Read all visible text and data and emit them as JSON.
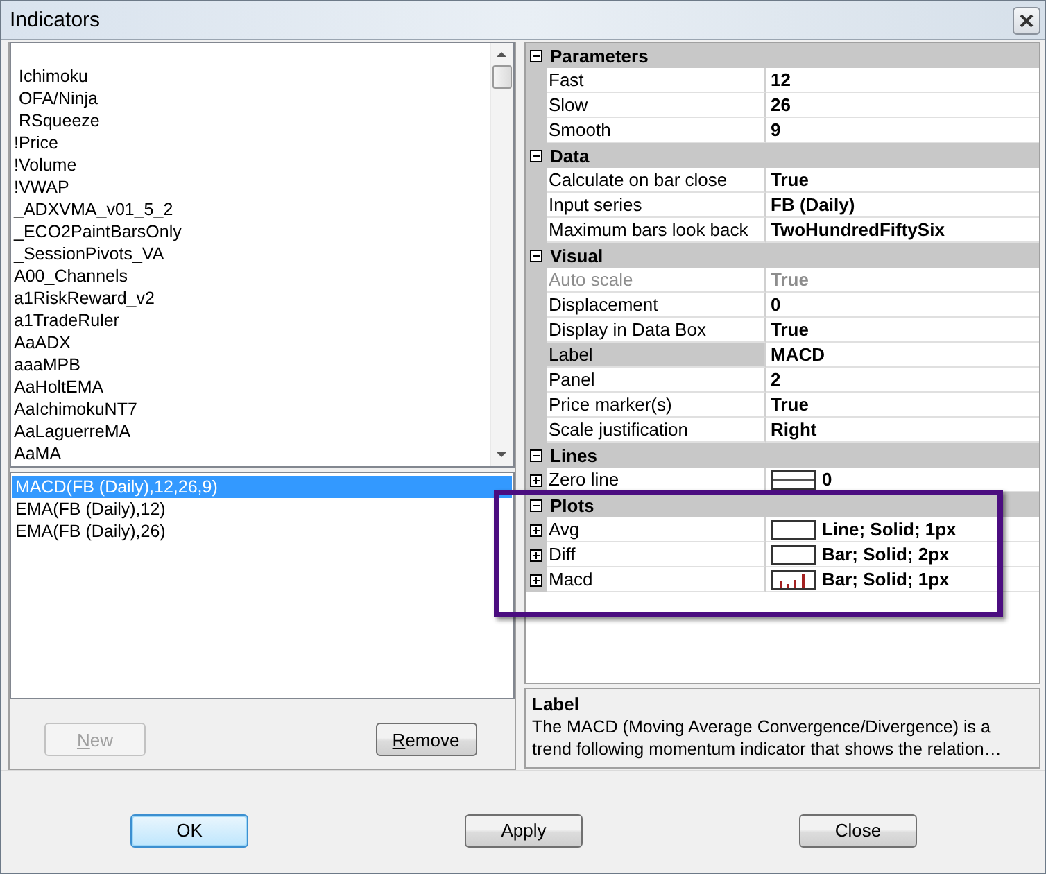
{
  "window": {
    "title": "Indicators"
  },
  "available_indicators": [
    " Ichimoku",
    " OFA/Ninja",
    " RSqueeze",
    "!Price",
    "!Volume",
    "!VWAP",
    "_ADXVMA_v01_5_2",
    "_ECO2PaintBarsOnly",
    "_SessionPivots_VA",
    "A00_Channels",
    "a1RiskReward_v2",
    "a1TradeRuler",
    "AaADX",
    "aaaMPB",
    "AaHoltEMA",
    "AaIchimokuNT7",
    "AaLaguerreMA",
    "AaMA"
  ],
  "applied_indicators": [
    {
      "label": "MACD(FB (Daily),12,26,9)",
      "selected": true
    },
    {
      "label": "EMA(FB (Daily),12)",
      "selected": false
    },
    {
      "label": "EMA(FB (Daily),26)",
      "selected": false
    }
  ],
  "list_buttons": [
    {
      "label": "New",
      "disabled": true
    },
    {
      "label": "Remove",
      "disabled": false
    }
  ],
  "properties": [
    {
      "title": "Parameters",
      "expanded": true,
      "highlighted": false,
      "rows": [
        {
          "name": "Fast",
          "value": "12",
          "kind": "plain",
          "expandable": false,
          "disabled": false,
          "selected": false
        },
        {
          "name": "Slow",
          "value": "26",
          "kind": "plain",
          "expandable": false,
          "disabled": false,
          "selected": false
        },
        {
          "name": "Smooth",
          "value": "9",
          "kind": "plain",
          "expandable": false,
          "disabled": false,
          "selected": false
        }
      ]
    },
    {
      "title": "Data",
      "expanded": true,
      "highlighted": false,
      "rows": [
        {
          "name": "Calculate on bar close",
          "value": "True",
          "kind": "plain",
          "expandable": false,
          "disabled": false,
          "selected": false
        },
        {
          "name": "Input series",
          "value": "FB (Daily)",
          "kind": "plain",
          "expandable": false,
          "disabled": false,
          "selected": false
        },
        {
          "name": "Maximum bars look back",
          "value": "TwoHundredFiftySix",
          "kind": "plain",
          "expandable": false,
          "disabled": false,
          "selected": false
        }
      ]
    },
    {
      "title": "Visual",
      "expanded": true,
      "highlighted": false,
      "rows": [
        {
          "name": "Auto scale",
          "value": "True",
          "kind": "plain",
          "expandable": false,
          "disabled": true,
          "selected": false
        },
        {
          "name": "Displacement",
          "value": "0",
          "kind": "plain",
          "expandable": false,
          "disabled": false,
          "selected": false
        },
        {
          "name": "Display in Data Box",
          "value": "True",
          "kind": "plain",
          "expandable": false,
          "disabled": false,
          "selected": false
        },
        {
          "name": "Label",
          "value": "MACD",
          "kind": "plain",
          "expandable": false,
          "disabled": false,
          "selected": true
        },
        {
          "name": "Panel",
          "value": "2",
          "kind": "plain",
          "expandable": false,
          "disabled": false,
          "selected": false
        },
        {
          "name": "Price marker(s)",
          "value": "True",
          "kind": "plain",
          "expandable": false,
          "disabled": false,
          "selected": false
        },
        {
          "name": "Scale justification",
          "value": "Right",
          "kind": "plain",
          "expandable": false,
          "disabled": false,
          "selected": false
        }
      ]
    },
    {
      "title": "Lines",
      "expanded": true,
      "highlighted": false,
      "rows": [
        {
          "name": "Zero line",
          "value": "0",
          "kind": "line",
          "expandable": true,
          "disabled": false,
          "selected": false
        }
      ]
    },
    {
      "title": "Plots",
      "expanded": true,
      "highlighted": true,
      "rows": [
        {
          "name": "Avg",
          "value": "Line; Solid; 1px",
          "kind": "blank",
          "expandable": true,
          "disabled": false,
          "selected": false
        },
        {
          "name": "Diff",
          "value": "Bar; Solid; 2px",
          "kind": "blank",
          "expandable": true,
          "disabled": false,
          "selected": false
        },
        {
          "name": "Macd",
          "value": "Bar; Solid; 1px",
          "kind": "bars",
          "expandable": true,
          "disabled": false,
          "selected": false
        }
      ]
    }
  ],
  "description": {
    "title": "Label",
    "text": "The MACD (Moving Average Convergence/Divergence) is a trend following momentum indicator that shows the relation…"
  },
  "dialog_buttons": [
    {
      "label": "OK",
      "default": true
    },
    {
      "label": "Apply",
      "default": false
    },
    {
      "label": "Close",
      "default": false
    }
  ]
}
